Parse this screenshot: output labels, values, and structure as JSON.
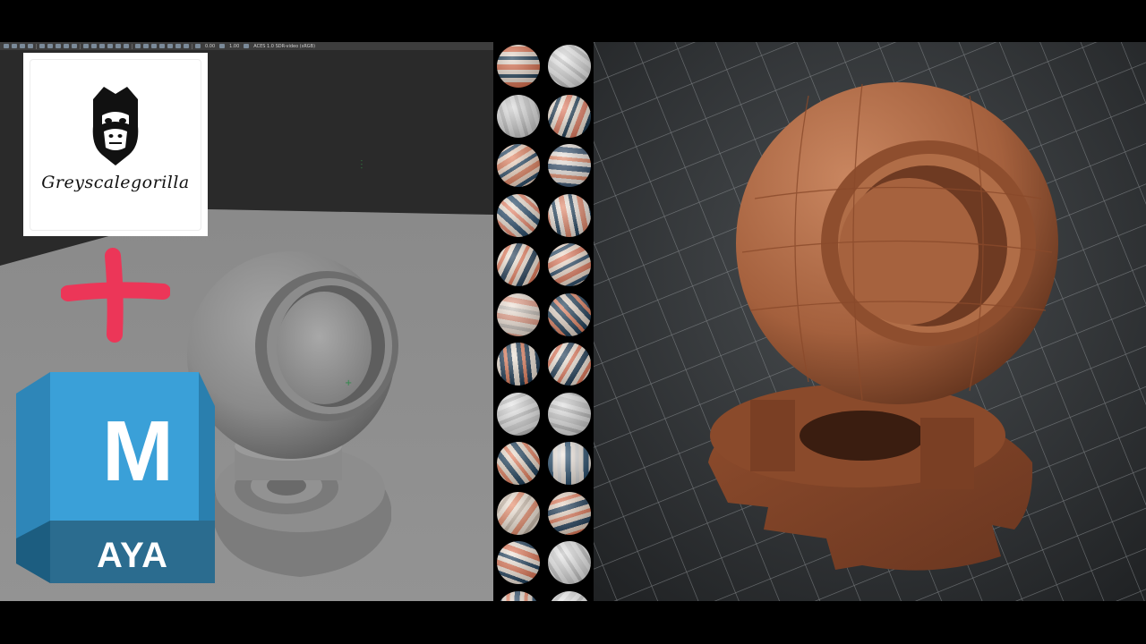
{
  "viewport": {
    "toolbar_readouts": [
      "0.00",
      "1.00",
      "ACES 1.0 SDR-video (sRGB)"
    ]
  },
  "logos": {
    "greyscalegorilla_text": "Greyscalegorilla",
    "maya_letter": "M",
    "maya_text": "AYA"
  },
  "swatches": [
    {
      "bg": "#e8d9cc",
      "c1": "#d9704f",
      "c2": "#1f3d55"
    },
    {
      "bg": "#e9e9e9",
      "c1": "#d6d6d6",
      "c2": "#c4c4c4"
    },
    {
      "bg": "#dcdcdc",
      "c1": "#c9c9c9",
      "c2": "#bcbcbc"
    },
    {
      "bg": "#efe2d4",
      "c1": "#e07a5f",
      "c2": "#1d3a52"
    },
    {
      "bg": "#f0d4c0",
      "c1": "#e0805e",
      "c2": "#2a4a66"
    },
    {
      "bg": "#e9e2dc",
      "c1": "#3a5470",
      "c2": "#e28c6c"
    },
    {
      "bg": "#ede0d2",
      "c1": "#2a4d6c",
      "c2": "#e8866a"
    },
    {
      "bg": "#efe5dc",
      "c1": "#e2886b",
      "c2": "#24445f"
    },
    {
      "bg": "#f2e3d4",
      "c1": "#243f58",
      "c2": "#e57c5b"
    },
    {
      "bg": "#f0dccc",
      "c1": "#e07a5d",
      "c2": "#2d4c68"
    },
    {
      "bg": "#f0e2d6",
      "c1": "#e6a08a",
      "c2": "#c9c2bb"
    },
    {
      "bg": "#1f3e57",
      "c1": "#e6d7c9",
      "c2": "#e0805f"
    },
    {
      "bg": "#1e3b55",
      "c1": "#f0e4d8",
      "c2": "#e07c5a"
    },
    {
      "bg": "#f0e3d6",
      "c1": "#1f3c56",
      "c2": "#e2785a"
    },
    {
      "bg": "#e6e6e6",
      "c1": "#d2d2d2",
      "c2": "#c2c2c2"
    },
    {
      "bg": "#dedede",
      "c1": "#c8c8c8",
      "c2": "#b8b8b8"
    },
    {
      "bg": "#ecdccc",
      "c1": "#20415c",
      "c2": "#e47f5d"
    },
    {
      "bg": "#ece4dc",
      "c1": "#2a4f6e",
      "c2": "#dadada"
    },
    {
      "bg": "#efe2d4",
      "c1": "#e58b6a",
      "c2": "#c9b9a9"
    },
    {
      "bg": "#e7d4c4",
      "c1": "#1f3c57",
      "c2": "#e07a5a"
    },
    {
      "bg": "#f0e4d8",
      "c1": "#e07858",
      "c2": "#20405c"
    },
    {
      "bg": "#e8e8e8",
      "c1": "#d4d4d4",
      "c2": "#c0c0c0"
    },
    {
      "bg": "#e6d8cc",
      "c1": "#2b4b68",
      "c2": "#e48262"
    },
    {
      "bg": "#ececec",
      "c1": "#d8d8d8",
      "c2": "#c6c6c6"
    }
  ]
}
